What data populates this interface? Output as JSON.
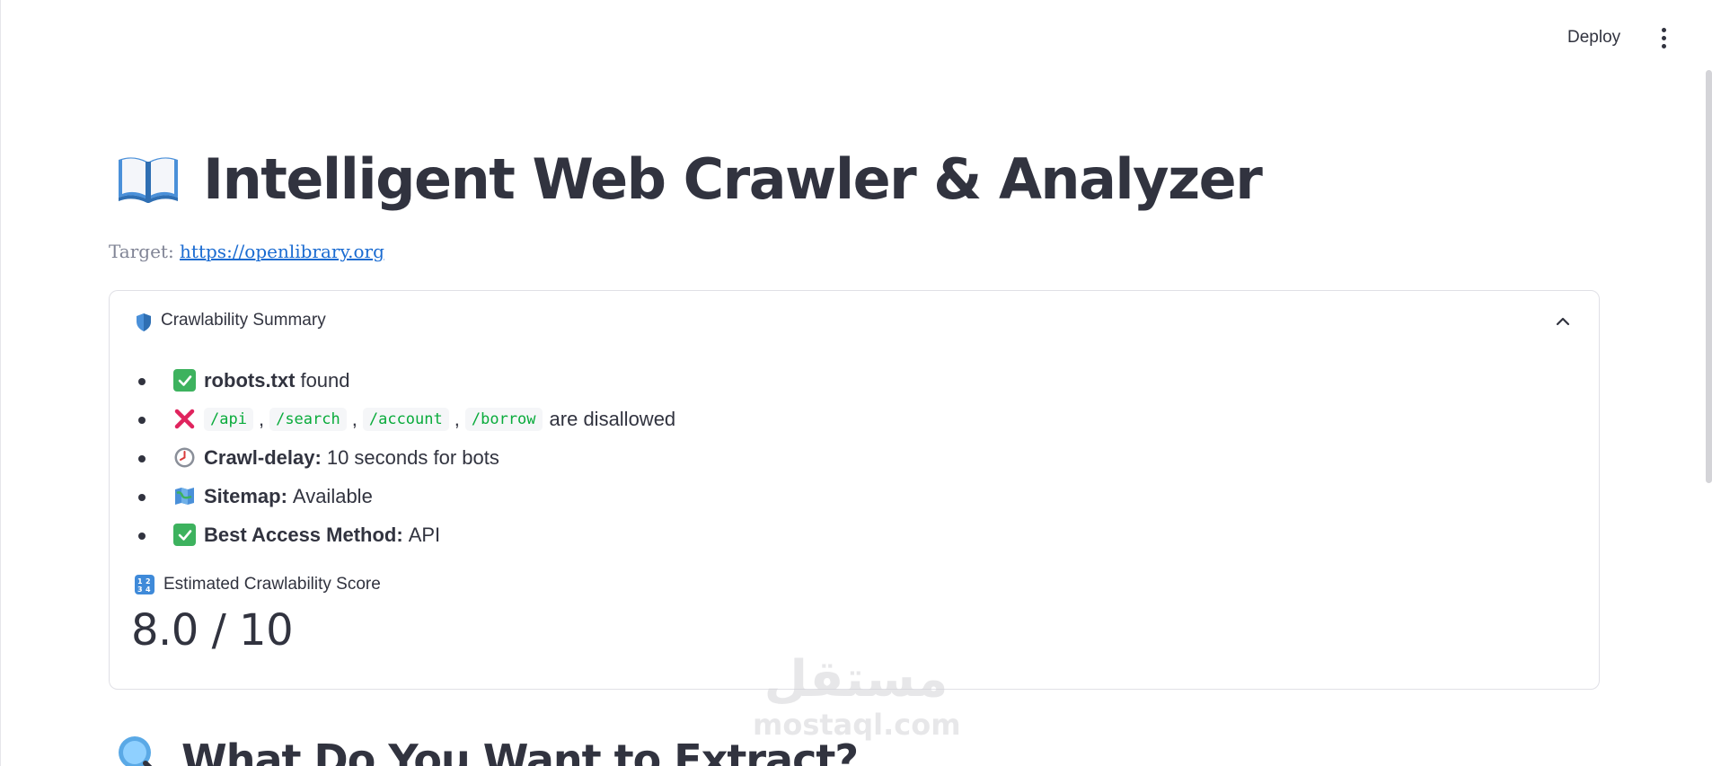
{
  "header": {
    "deploy_label": "Deploy",
    "menu_icon": "kebab-vertical-icon"
  },
  "title": {
    "icon": "open-book-icon",
    "text": "Intelligent Web Crawler & Analyzer"
  },
  "target": {
    "label": "Target:",
    "url": "https://openlibrary.org"
  },
  "summary": {
    "icon": "shield-icon",
    "label": "Crawlability Summary",
    "chevron_icon": "chevron-up-icon",
    "items": [
      {
        "icon": "check-mark-icon",
        "bold": "robots.txt",
        "text": "found"
      },
      {
        "icon": "cross-mark-icon",
        "codes": [
          "/api",
          "/search",
          "/account",
          "/borrow"
        ],
        "separator": ",",
        "text": "are disallowed"
      },
      {
        "icon": "clock-icon",
        "bold": "Crawl-delay:",
        "text": "10 seconds for bots"
      },
      {
        "icon": "map-icon",
        "bold": "Sitemap:",
        "text": "Available"
      },
      {
        "icon": "check-mark-icon",
        "bold": "Best Access Method:",
        "text": "API"
      }
    ],
    "metric": {
      "icon": "numbers-icon",
      "label": "Estimated Crawlability Score",
      "value": "8.0 / 10"
    }
  },
  "section2": {
    "icon": "magnifier-icon",
    "title": "What Do You Want to Extract?"
  },
  "watermark": {
    "arabic": "مستقل",
    "latin": "mostaql.com"
  },
  "colors": {
    "text": "#31333f",
    "link": "#1a6bd1",
    "code": "#09ab3b",
    "check_green": "#3db25e",
    "cross_red": "#e0245e"
  }
}
